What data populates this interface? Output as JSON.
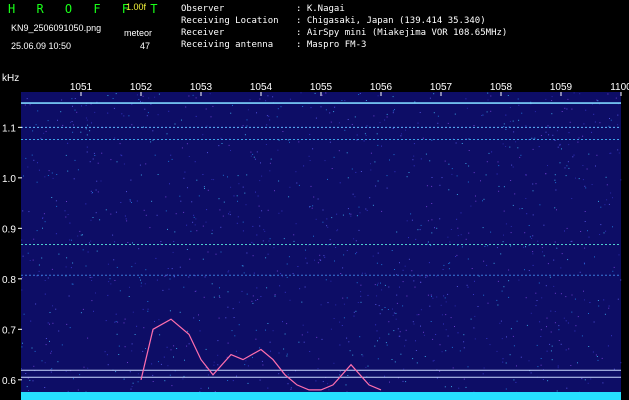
{
  "header": {
    "app_title": "H R O F F T",
    "version": "1.00f",
    "filename": "KN9_2506091050.png",
    "datetime": "25.06.09 10:50",
    "meteor_label": "meteor",
    "meteor_count": "47",
    "info": [
      {
        "label": "Observer",
        "value": ": K.Nagai"
      },
      {
        "label": "Receiving Location",
        "value": ": Chigasaki, Japan (139.414 35.340)"
      },
      {
        "label": "Receiver",
        "value": ": AirSpy mini (Miakejima VOR 108.65MHz)"
      },
      {
        "label": "Receiving antenna",
        "value": ": Maspro FM-3"
      }
    ]
  },
  "colors": {
    "background": "#000000",
    "waterfall_base": "#0d0d66",
    "header_title": "#19ff19",
    "version_text": "#f3f33a",
    "trace": "#ff6fae",
    "signal_band": "#26e0ff"
  },
  "chart_data": {
    "type": "heatmap",
    "xlabel": "",
    "ylabel": "kHz",
    "x_ticks": [
      "1051",
      "1052",
      "1053",
      "1054",
      "1055",
      "1056",
      "1057",
      "1058",
      "1059",
      "1100"
    ],
    "y_ticks": [
      "1.1",
      "1.0",
      "0.9",
      "0.8",
      "0.7",
      "0.6"
    ],
    "x_range": [
      "1050",
      "1100"
    ],
    "y_range": [
      0.56,
      1.17
    ],
    "grid": false,
    "horizontal_lines_khz": [
      1.148,
      1.1,
      1.076,
      0.868,
      0.807,
      0.619,
      0.605
    ],
    "meteor_echo_trace": {
      "x": [
        "1052",
        "1052.2",
        "1052.5",
        "1052.8",
        "1053",
        "1053.2",
        "1053.5",
        "1053.7",
        "1054",
        "1054.2",
        "1054.4",
        "1054.6",
        "1054.8",
        "1055",
        "1055.2",
        "1055.5",
        "1055.8",
        "1056"
      ],
      "khz": [
        0.6,
        0.7,
        0.72,
        0.69,
        0.64,
        0.61,
        0.65,
        0.64,
        0.66,
        0.64,
        0.61,
        0.59,
        0.58,
        0.58,
        0.59,
        0.63,
        0.59,
        0.58
      ]
    }
  }
}
